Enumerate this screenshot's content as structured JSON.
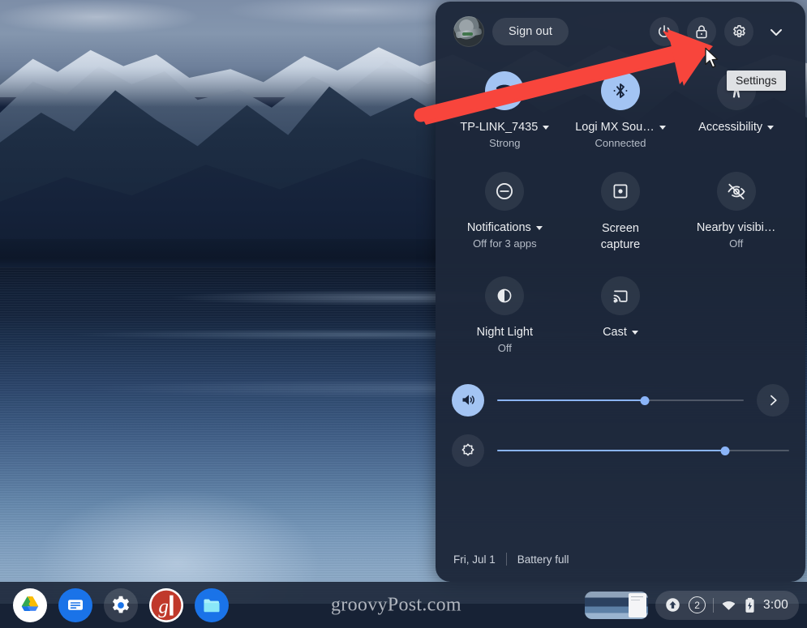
{
  "wallpaper": {
    "description": "dark-blue mountain lake at dusk"
  },
  "quick_settings": {
    "header": {
      "avatar_name": "user-avatar",
      "sign_out_label": "Sign out",
      "power_icon": "power-icon",
      "lock_icon": "lock-icon",
      "settings_icon": "gear-icon",
      "collapse_icon": "chevron-down-icon"
    },
    "tiles": [
      {
        "id": "wifi",
        "icon": "wifi-locked-icon",
        "label": "TP-LINK_7435",
        "sub": "Strong",
        "caret": true,
        "active": true,
        "two_line": false
      },
      {
        "id": "bluetooth",
        "icon": "bluetooth-icon",
        "label": "Logi MX Sou…",
        "sub": "Connected",
        "caret": true,
        "active": true,
        "two_line": false
      },
      {
        "id": "accessibility",
        "icon": "accessibility-icon",
        "label": "Accessibility",
        "sub": "",
        "caret": true,
        "active": false,
        "two_line": false
      },
      {
        "id": "notifications",
        "icon": "do-not-disturb-icon",
        "label": "Notifications",
        "sub": "Off for 3 apps",
        "caret": true,
        "active": false,
        "two_line": false
      },
      {
        "id": "screen_capture",
        "icon": "screen-capture-icon",
        "label": "Screen\ncapture",
        "sub": "",
        "caret": false,
        "active": false,
        "two_line": true
      },
      {
        "id": "nearby",
        "icon": "eye-off-icon",
        "label": "Nearby visibi…",
        "sub": "Off",
        "caret": false,
        "active": false,
        "two_line": false
      },
      {
        "id": "night_light",
        "icon": "night-light-icon",
        "label": "Night Light",
        "sub": "Off",
        "caret": false,
        "active": false,
        "two_line": false
      },
      {
        "id": "cast",
        "icon": "cast-icon",
        "label": "Cast",
        "sub": "",
        "caret": true,
        "active": false,
        "two_line": false
      }
    ],
    "sliders": [
      {
        "id": "volume",
        "icon": "volume-up-icon",
        "percent": 60,
        "expand_icon": "chevron-right-icon"
      },
      {
        "id": "brightness",
        "icon": "brightness-icon",
        "percent": 78,
        "expand_icon": ""
      }
    ],
    "footer": {
      "date": "Fri, Jul 1",
      "battery": "Battery full"
    }
  },
  "tooltip": {
    "text": "Settings"
  },
  "annotation": {
    "arrow_color": "#f8453c",
    "points_at": "gear-icon"
  },
  "cursor": {
    "type": "default-pointer"
  },
  "shelf": {
    "apps": [
      {
        "id": "drive",
        "icon": "google-drive-icon",
        "label": "Google Drive"
      },
      {
        "id": "messages",
        "icon": "messages-icon",
        "label": "Messages"
      },
      {
        "id": "settings",
        "icon": "gear-icon",
        "label": "Settings"
      },
      {
        "id": "groovypost",
        "icon": "groovypost-g-icon",
        "label": "groovyPost"
      },
      {
        "id": "files",
        "icon": "folder-icon",
        "label": "Files"
      }
    ],
    "watermark": "groovyPost.com",
    "window_preview": {
      "name": "browser-window-preview"
    },
    "status_tray": {
      "upload_icon": "arrow-up-circle-icon",
      "notification_count": "2",
      "wifi_icon": "wifi-icon",
      "battery_icon": "battery-full-icon",
      "clock": "3:00"
    }
  },
  "colors": {
    "panel_bg": "#1d273a",
    "accent": "#8ab4f8",
    "tile_on": "#a3c4f3",
    "arrow": "#f8453c",
    "tooltip_bg": "#dfe1e4"
  }
}
